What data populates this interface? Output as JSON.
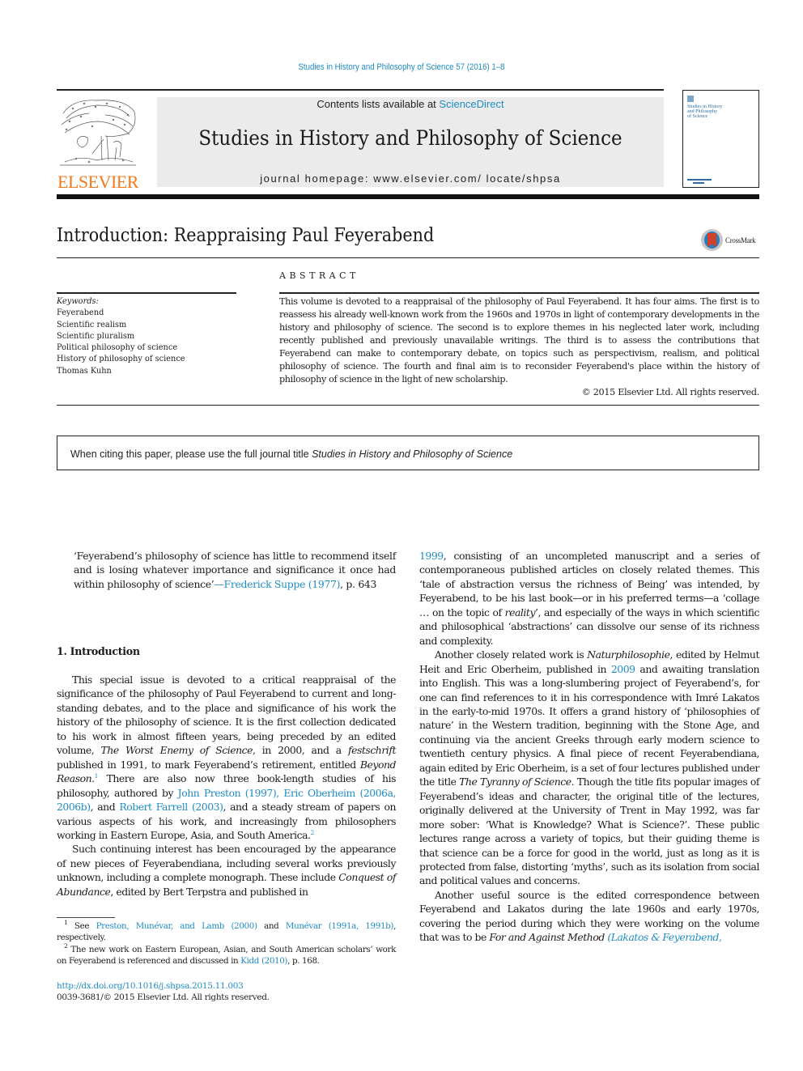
{
  "running_head": "Studies in History and Philosophy of Science 57 (2016) 1–8",
  "masthead": {
    "publisher_wordmark": "ELSEVIER",
    "contents_prefix": "Contents lists available at ",
    "contents_link": "ScienceDirect",
    "journal_title": "Studies in History and Philosophy of Science",
    "homepage_label": "journal homepage: www.elsevier.com/ locate/shpsa",
    "cover_title_lines": [
      "Studies in History",
      "and Philosophy",
      "of Science"
    ],
    "logo_icon": "elsevier-tree-icon",
    "cover_icon": "journal-cover-thumbnail"
  },
  "article": {
    "title": "Introduction: Reappraising Paul Feyerabend",
    "crossmark_label": "CrossMark",
    "crossmark_icon": "crossmark-icon"
  },
  "abstract": {
    "heading": "ABSTRACT",
    "text": "This volume is devoted to a reappraisal of the philosophy of Paul Feyerabend. It has four aims. The first is to reassess his already well-known work from the 1960s and 1970s in light of contemporary developments in the history and philosophy of science. The second is to explore themes in his neglected later work, including recently published and previously unavailable writings. The third is to assess the contributions that Feyerabend can make to contemporary debate, on topics such as perspectivism, realism, and political philosophy of science. The fourth and final aim is to reconsider Feyerabend's place within the history of philosophy of science in the light of new scholarship.",
    "copyright": "© 2015 Elsevier Ltd. All rights reserved."
  },
  "keywords": {
    "label": "Keywords:",
    "items": [
      "Feyerabend",
      "Scientific realism",
      "Scientific pluralism",
      "Political philosophy of science",
      "History of philosophy of science",
      "Thomas Kuhn"
    ]
  },
  "citing_notice": {
    "text": "When citing this paper, please use the full journal title ",
    "journal": "Studies in History and Philosophy of Science"
  },
  "epigraph": {
    "quote": "‘Feyerabend’s philosophy of science has little to recommend itself and is losing whatever importance and significance it once had within philosophy of science’",
    "dash": "—",
    "author_link": "Frederick Suppe (1977)",
    "page": ", p. 643"
  },
  "section": {
    "heading": "1.  Introduction"
  },
  "body": {
    "p1": {
      "a": "This special issue is devoted to a critical reappraisal of the significance of the philosophy of Paul Feyerabend to current and long-standing debates, and to the place and significance of his work the history of the philosophy of science. It is the first collection dedicated to his work in almost fifteen years, being preceded by an edited volume, ",
      "b_italic": "The Worst Enemy of Science",
      "c": ", in 2000, and a ",
      "d_italic": "festschrift",
      "e": " published in 1991, to mark Feyerabend’s retirement, entitled ",
      "f_italic": "Beyond Reason",
      "g": ".",
      "fn1": "1",
      "h": " There are also now three book-length studies of his philosophy, authored by ",
      "link1": "John Preston (1997), Eric Oberheim (2006a, 2006b)",
      "i": ", and ",
      "link2": "Robert Farrell (2003)",
      "j": ", and a steady stream of papers on various aspects of his work, and increasingly from philosophers working in Eastern Europe, Asia, and South America.",
      "fn2": "2"
    },
    "p2": {
      "a": "Such continuing interest has been encouraged by the appearance of new pieces of Feyerabendiana, including several works previously unknown, including a complete monograph. These include ",
      "b_italic": "Conquest of Abundance",
      "c": ", edited by Bert Terpstra and published in ",
      "link1": "1999",
      "d": ", consisting of an uncompleted manuscript and a series of contemporaneous published articles on closely related themes. This ‘tale of abstraction versus the richness of Being’ was intended, by Feyerabend, to be his last book—or in his preferred terms—a ‘collage … on the topic of ",
      "e_italic": "reality",
      "f": "’, and especially of the ways in which scientific and philosophical ‘abstractions’ can dissolve our sense of its richness and complexity."
    },
    "p3": {
      "a": "Another closely related work is ",
      "b_italic": "Naturphilosophie",
      "c": ", edited by Helmut Heit and Eric Oberheim, published in ",
      "link1": "2009",
      "d": " and awaiting translation into English. This was a long-slumbering project of Feyerabend’s, for one can find references to it in his correspondence with Imré Lakatos in the early-to-mid 1970s. It offers a grand history of ‘philosophies of nature’ in the Western tradition, beginning with the Stone Age, and continuing via the ancient Greeks through early modern science to twentieth century physics. A final piece of recent Feyerabendiana, again edited by Eric Oberheim, is a set of four lectures published under the title ",
      "e_italic": "The Tyranny of Science",
      "f": ". Though the title fits popular images of Feyerabend’s ideas and character, the original title of the lectures, originally delivered at the University of Trent in May 1992, was far more sober: ‘What is Knowledge? What is Science?’. These public lectures range across a variety of topics, but their guiding theme is that science can be a force for good in the world, just as long as it is protected from false, distorting ‘myths’, such as its isolation from social and political values and concerns."
    },
    "p4": {
      "a": "Another useful source is the edited correspondence between Feyerabend and Lakatos during the late 1960s and early 1970s, covering the period during which they were working on the volume that was to be ",
      "b_italic": "For and Against Method",
      "c": " (",
      "link1": "Lakatos & Feyerabend,"
    }
  },
  "footnotes": [
    {
      "num": "1",
      "a": " See ",
      "link1": "Preston, Munévar, and Lamb (2000)",
      "b": " and ",
      "link2": "Munévar (1991a, 1991b)",
      "c": ", respectively."
    },
    {
      "num": "2",
      "a": " The new work on Eastern European, Asian, and South American scholars’ work on Feyerabend is referenced and discussed in ",
      "link1": "Kidd (2010)",
      "b": ", p. 168."
    }
  ],
  "doi_link": "http://dx.doi.org/10.1016/j.shpsa.2015.11.003",
  "issn_line": "0039-3681/© 2015 Elsevier Ltd. All rights reserved.",
  "colors": {
    "link": "#1f8bc3",
    "elsevier_orange": "#f07a1e",
    "banner_gray": "#ebebeb",
    "crossmark_red": "#d0402b",
    "crossmark_blue": "#2a7bbf"
  }
}
